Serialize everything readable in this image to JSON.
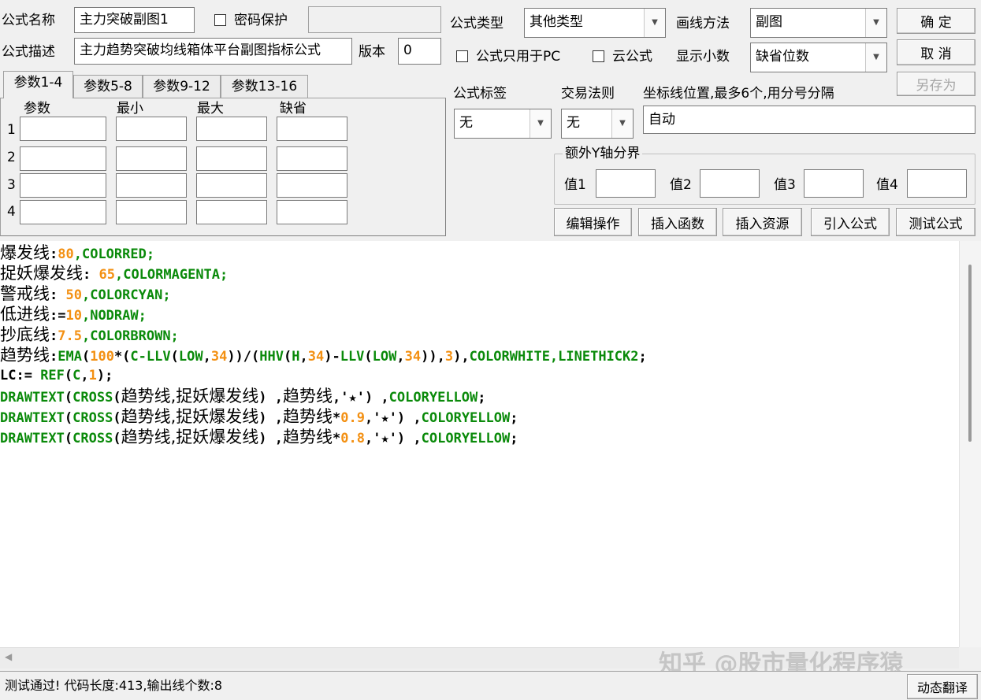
{
  "labels": {
    "formula_name": "公式名称",
    "password_protect": "密码保护",
    "formula_desc": "公式描述",
    "version": "版本",
    "formula_type": "公式类型",
    "draw_method": "画线方法",
    "pc_only": "公式只用于PC",
    "cloud_formula": "云公式",
    "show_decimals": "显示小数",
    "formula_tag": "公式标签",
    "trade_rule": "交易法则",
    "coord_lines": "坐标线位置,最多6个,用分号分隔",
    "extra_y_axis": "额外Y轴分界",
    "value1": "值1",
    "value2": "值2",
    "value3": "值3",
    "value4": "值4"
  },
  "fields": {
    "formula_name": "主力突破副图1",
    "password": "",
    "formula_desc": "主力趋势突破均线箱体平台副图指标公式",
    "version": "0",
    "coord_lines": "自动"
  },
  "selects": {
    "formula_type": "其他类型",
    "draw_method": "副图",
    "show_decimals": "缺省位数",
    "formula_tag": "无",
    "trade_rule": "无"
  },
  "buttons": {
    "ok": "确  定",
    "cancel": "取  消",
    "save_as": "另存为",
    "edit_ops": "编辑操作",
    "insert_func": "插入函数",
    "insert_resource": "插入资源",
    "import_formula": "引入公式",
    "test_formula": "测试公式",
    "dynamic_translate": "动态翻译"
  },
  "params": {
    "tabs": [
      "参数1-4",
      "参数5-8",
      "参数9-12",
      "参数13-16"
    ],
    "headers": [
      "参数",
      "最小",
      "最大",
      "缺省"
    ],
    "rows": [
      "1",
      "2",
      "3",
      "4"
    ]
  },
  "code": {
    "l1a": "爆发线",
    "l1b": ":",
    "l1c": "80",
    "l1d": ",COLORRED;",
    "l2a": "捉妖爆发线",
    "l2b": ": ",
    "l2c": "65",
    "l2d": ",COLORMAGENTA;",
    "l3a": "警戒线",
    "l3b": ": ",
    "l3c": "50",
    "l3d": ",COLORCYAN;",
    "l4a": "低进线",
    "l4b": ":=",
    "l4c": "10",
    "l4d": ",NODRAW;",
    "l5a": "抄底线",
    "l5b": ":",
    "l5c": "7.5",
    "l5d": ",COLORBROWN;",
    "l6a": "趋势线",
    "l6b": ":",
    "l6c": "EMA",
    "l6d": "(",
    "l6e": "100",
    "l6f": "*(",
    "l6g": "C-LLV",
    "l6h": "(",
    "l6i": "LOW",
    "l6j": ",",
    "l6k": "34",
    "l6l": "))/(",
    "l6m": "HHV",
    "l6n": "(",
    "l6o": "H",
    "l6p": ",",
    "l6q": "34",
    "l6r": ")-",
    "l6s": "LLV",
    "l6t": "(",
    "l6u": "LOW",
    "l6v": ",",
    "l6w": "34",
    "l6x": ")),",
    "l6y": "3",
    "l6z": "),",
    "l6za": "COLORWHITE,LINETHICK2",
    "l6zb": ";",
    "l7a": "LC:= ",
    "l7b": "REF",
    "l7c": "(",
    "l7d": "C",
    "l7e": ",",
    "l7f": "1",
    "l7g": ");",
    "l8a": "DRAWTEXT",
    "l8b": "(",
    "l8c": "CROSS",
    "l8d": "(",
    "l8e": "趋势线,捉妖爆发线",
    "l8f": ") ,",
    "l8g": "趋势线",
    "l8h": ",'",
    "l8i": "★",
    "l8j": "') ,",
    "l8k": "COLORYELLOW",
    "l8l": ";",
    "l9a": "DRAWTEXT",
    "l9b": "(",
    "l9c": "CROSS",
    "l9d": "(",
    "l9e": "趋势线,捉妖爆发线",
    "l9f": ") ,",
    "l9g": "趋势线",
    "l9h": "*",
    "l9i": "0.9",
    "l9j": ",'",
    "l9k": "★",
    "l9l": "') ,",
    "l9m": "COLORYELLOW",
    "l9n": ";",
    "l10a": "DRAWTEXT",
    "l10b": "(",
    "l10c": "CROSS",
    "l10d": "(",
    "l10e": "趋势线,捉妖爆发线",
    "l10f": ") ,",
    "l10g": "趋势线",
    "l10h": "*",
    "l10i": "0.8",
    "l10j": ",'",
    "l10k": "★",
    "l10l": "') ,",
    "l10m": "COLORYELLOW",
    "l10n": ";"
  },
  "status": {
    "message": "测试通过! 代码长度:413,输出线个数:8",
    "watermark": "知乎 @股市量化程序猿"
  },
  "colors": {
    "keyword": "#0a8a0a",
    "number": "#f39012",
    "text": "#000000"
  }
}
